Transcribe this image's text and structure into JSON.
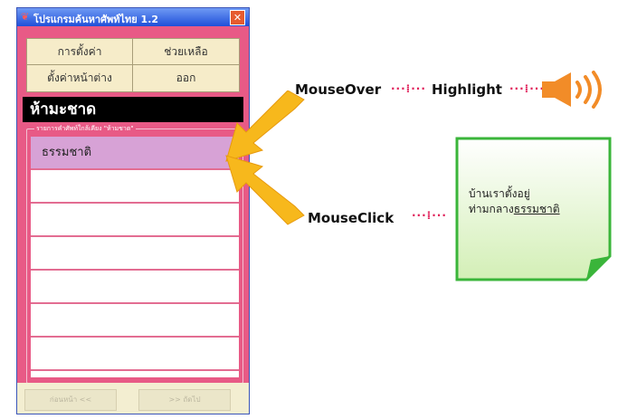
{
  "window": {
    "title": "โปรแกรมค้นหาศัพท์ไทย 1.2",
    "close": "✕",
    "menu": {
      "settings": "การตั้งค่า",
      "help": "ช่วยเหลือ",
      "set_home": "ตั้งค่าหน้าต่าง",
      "exit": "ออก"
    },
    "search_word": "ห้ามะชาด",
    "results_legend": "รายการคำศัพท์ใกล้เคียง \"ห้ามชาด\"",
    "results": [
      "ธรรมชาติ",
      "",
      "",
      "",
      "",
      "",
      ""
    ],
    "nav": {
      "prev": "ก่อนหน้า <<",
      "next": ">> ถัดไป"
    }
  },
  "annotations": {
    "mouseover": "MouseOver",
    "highlight": "Highlight",
    "mouseclick": "MouseClick",
    "connector": "···⁞···",
    "icons": [
      "speaker-icon",
      "arrow-icon"
    ]
  },
  "note": {
    "line1": "บ้านเราตั้งอยู่",
    "line2_prefix": "ท่ามกลาง",
    "line2_word": "ธรรมชาติ"
  },
  "colors": {
    "window_bg": "#e85a86",
    "selected_row": "#d7a2d6",
    "arrow": "#f7b81c",
    "speaker": "#f28c28",
    "note_border": "#3ab53a",
    "note_fill": "#dff2c6",
    "connector": "#e0205a"
  }
}
